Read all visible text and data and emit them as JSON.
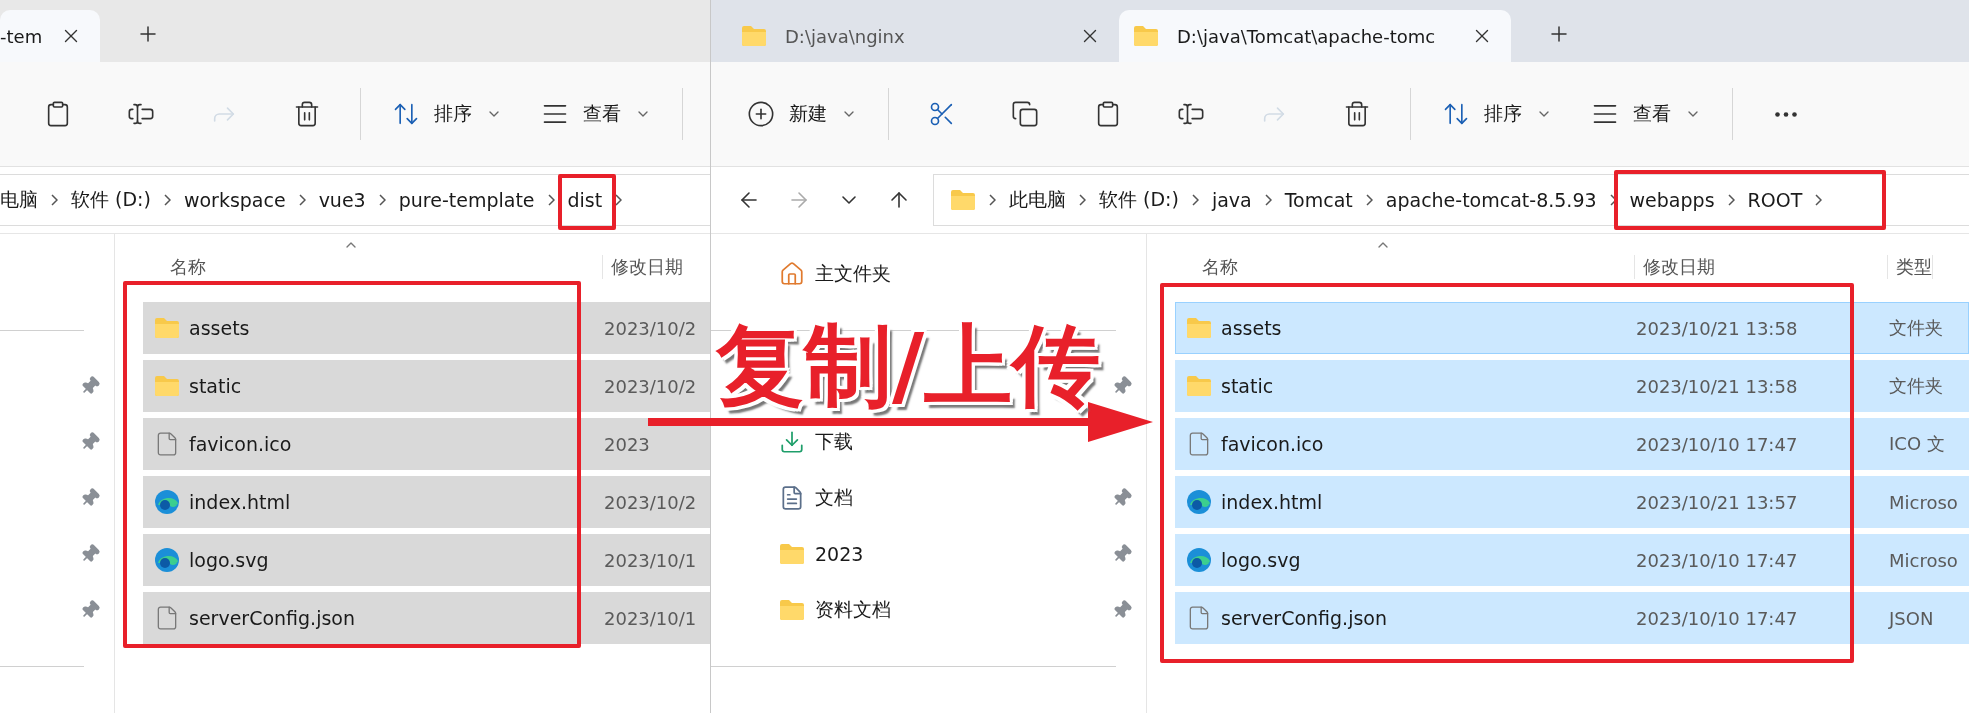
{
  "left_window": {
    "tabs": [
      {
        "title": "-tem",
        "selected": true
      }
    ],
    "toolbar": [
      {
        "kind": "paste",
        "disabled": false
      },
      {
        "kind": "rename",
        "disabled": false
      },
      {
        "kind": "share",
        "disabled": true
      },
      {
        "kind": "delete",
        "disabled": false
      },
      {
        "kind": "separator"
      },
      {
        "kind": "sort",
        "label": "排序",
        "disabled": false
      },
      {
        "kind": "view",
        "label": "查看",
        "disabled": false
      },
      {
        "kind": "separator"
      }
    ],
    "breadcrumb": [
      "电脑",
      "软件 (D:)",
      "workspace",
      "vue3",
      "pure-template",
      "dist"
    ],
    "sidebar": [
      {
        "kind": "blank"
      },
      {
        "kind": "divider"
      },
      {
        "kind": "blank",
        "pinned": true
      },
      {
        "kind": "blank",
        "pinned": true
      },
      {
        "kind": "blank",
        "pinned": true
      },
      {
        "kind": "blank",
        "pinned": true
      },
      {
        "kind": "blank",
        "pinned": true
      },
      {
        "kind": "divider"
      }
    ],
    "columns": [
      "名称",
      "修改日期"
    ],
    "files": [
      {
        "kind": "folder",
        "name": "assets",
        "date": "2023/10/2",
        "selected": true
      },
      {
        "kind": "folder",
        "name": "static",
        "date": "2023/10/2",
        "selected": true
      },
      {
        "kind": "file",
        "name": "favicon.ico",
        "date": "2023",
        "selected": true
      },
      {
        "kind": "browser",
        "name": "index.html",
        "date": "2023/10/2",
        "selected": true
      },
      {
        "kind": "browser",
        "name": "logo.svg",
        "date": "2023/10/1",
        "selected": true
      },
      {
        "kind": "file",
        "name": "serverConfig.json",
        "date": "2023/10/1",
        "selected": true
      }
    ]
  },
  "right_window": {
    "tabs": [
      {
        "title": "D:\\java\\nginx",
        "selected": false
      },
      {
        "title": "D:\\java\\Tomcat\\apache-tomc",
        "selected": true
      }
    ],
    "toolbar": [
      {
        "kind": "new",
        "label": "新建",
        "disabled": false
      },
      {
        "kind": "separator"
      },
      {
        "kind": "cut",
        "disabled": false
      },
      {
        "kind": "copy",
        "disabled": false
      },
      {
        "kind": "paste",
        "disabled": false
      },
      {
        "kind": "rename",
        "disabled": false
      },
      {
        "kind": "share",
        "disabled": true
      },
      {
        "kind": "delete",
        "disabled": false
      },
      {
        "kind": "separator"
      },
      {
        "kind": "sort",
        "label": "排序",
        "disabled": false
      },
      {
        "kind": "view",
        "label": "查看",
        "disabled": false
      },
      {
        "kind": "separator"
      },
      {
        "kind": "more",
        "disabled": false
      }
    ],
    "nav": [
      {
        "kind": "back",
        "disabled": false
      },
      {
        "kind": "forward",
        "disabled": true
      },
      {
        "kind": "recent",
        "disabled": false
      },
      {
        "kind": "up",
        "disabled": false
      }
    ],
    "breadcrumb": [
      "此电脑",
      "软件 (D:)",
      "java",
      "Tomcat",
      "apache-tomcat-8.5.93",
      "webapps",
      "ROOT"
    ],
    "sidebar": [
      {
        "kind": "home",
        "label": "主文件夹",
        "pinned": false
      },
      {
        "kind": "divider"
      },
      {
        "kind": "blank",
        "pinned": true
      },
      {
        "kind": "downloads",
        "label": "下载",
        "pinned": false
      },
      {
        "kind": "documents",
        "label": "文档",
        "pinned": true
      },
      {
        "kind": "folder",
        "label": "2023",
        "pinned": true
      },
      {
        "kind": "folder",
        "label": "资料文档",
        "pinned": true
      },
      {
        "kind": "divider"
      }
    ],
    "columns": [
      "名称",
      "修改日期",
      "类型"
    ],
    "files": [
      {
        "kind": "folder",
        "name": "assets",
        "date": "2023/10/21 13:58",
        "type": "文件夹",
        "selected": true
      },
      {
        "kind": "folder",
        "name": "static",
        "date": "2023/10/21 13:58",
        "type": "文件夹",
        "selected": true
      },
      {
        "kind": "file",
        "name": "favicon.ico",
        "date": "2023/10/10 17:47",
        "type": "ICO 文",
        "selected": true
      },
      {
        "kind": "browser",
        "name": "index.html",
        "date": "2023/10/21 13:57",
        "type": "Microso",
        "selected": true
      },
      {
        "kind": "browser",
        "name": "logo.svg",
        "date": "2023/10/10 17:47",
        "type": "Microso",
        "selected": true
      },
      {
        "kind": "file",
        "name": "serverConfig.json",
        "date": "2023/10/10 17:47",
        "type": "JSON",
        "selected": true
      }
    ]
  },
  "annotation": {
    "caption": "复制/上传"
  }
}
